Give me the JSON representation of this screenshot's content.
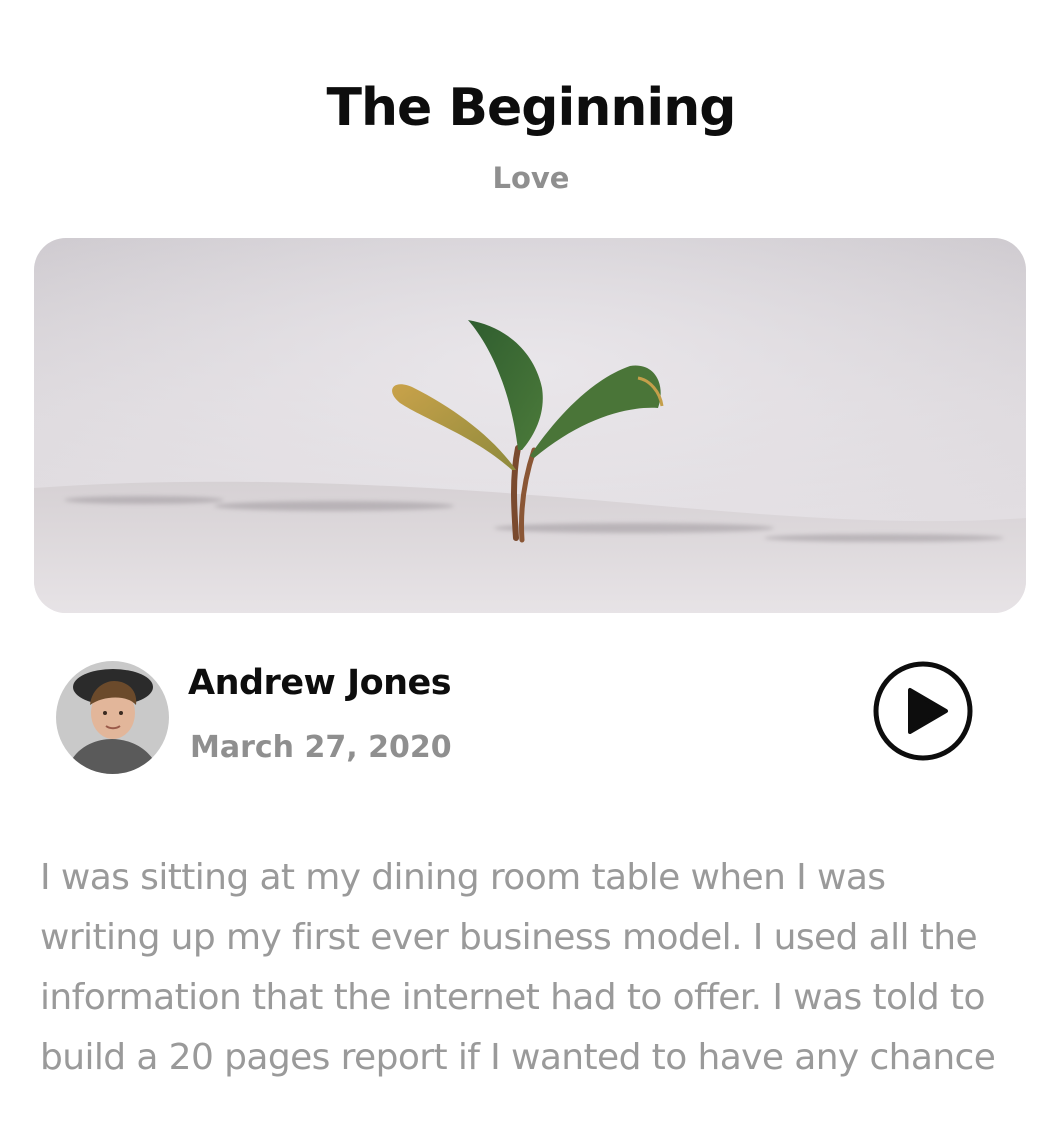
{
  "post": {
    "title": "The Beginning",
    "category": "Love"
  },
  "hero": {
    "subject": "seedling-in-sand"
  },
  "author": {
    "name": "Andrew Jones",
    "date": "March 27, 2020"
  },
  "player": {
    "icon": "play-icon"
  },
  "body": {
    "lines": [
      "I was sitting at my dining room table when I was",
      "writing up my first ever business model. I used all the",
      "information that the internet had to offer. I was told to",
      "build a 20 pages report if I wanted to have any chance"
    ]
  },
  "colors": {
    "title": "#0d0d0d",
    "muted": "#8f8f8f",
    "body": "#9a9a9a"
  }
}
